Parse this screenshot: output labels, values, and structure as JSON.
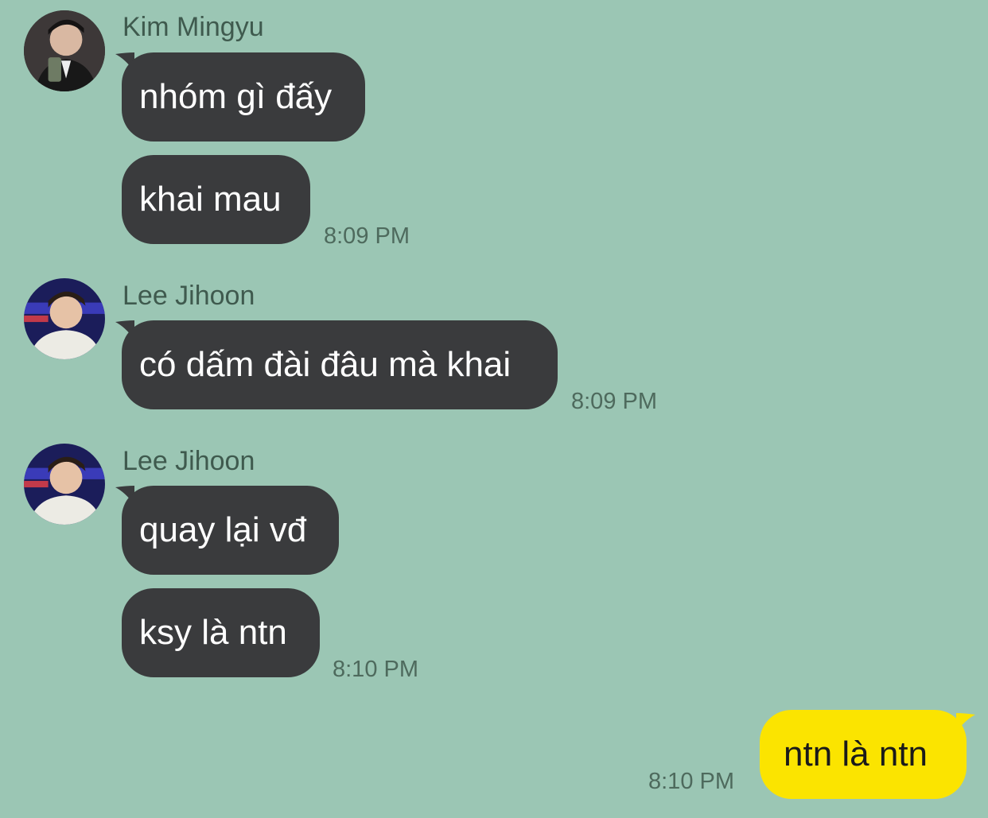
{
  "colors": {
    "background": "#9bc6b4",
    "incoming_bubble": "#3a3b3d",
    "outgoing_bubble": "#fbe400",
    "name_text": "#3f5a4e",
    "time_text": "#4e6a5d"
  },
  "messages": {
    "g1": {
      "sender": "Kim Mingyu",
      "avatar_icon": "profile-photo-icon",
      "m1": "nhóm gì đấy",
      "m2": "khai mau",
      "time": "8:09 PM"
    },
    "g2": {
      "sender": "Lee Jihoon",
      "avatar_icon": "profile-photo-icon",
      "m1": "có dấm đài đâu mà khai",
      "time": "8:09 PM"
    },
    "g3": {
      "sender": "Lee Jihoon",
      "avatar_icon": "profile-photo-icon",
      "m1": "quay lại vđ",
      "m2": "ksy là ntn",
      "time": "8:10 PM"
    },
    "out": {
      "m1": "ntn là ntn",
      "time": "8:10 PM"
    }
  }
}
